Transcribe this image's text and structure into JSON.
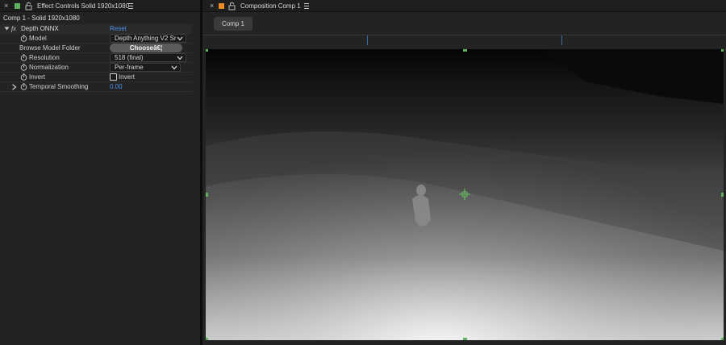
{
  "effect_controls": {
    "tab_title": "Effect Controls Solid 1920x1080",
    "layer_title": "Comp 1 - Solid 1920x1080",
    "effect": {
      "fx_badge": "fx",
      "name": "Depth ONNX",
      "reset_label": "Reset"
    },
    "properties": {
      "model": {
        "label": "Model",
        "value": "Depth Anything V2 Sm"
      },
      "browse": {
        "label": "Browse Model Folder",
        "button_label": "Chooseâ€¦"
      },
      "resolution": {
        "label": "Resolution",
        "value": "518 (final)"
      },
      "normalization": {
        "label": "Normalization",
        "value": "Per-frame"
      },
      "invert": {
        "label": "Invert",
        "checkbox_label": "Invert",
        "checked": false
      },
      "temporal_smoothing": {
        "label": "Temporal Smoothing",
        "value": "0.00"
      }
    },
    "swatch_color": "#5fb35f"
  },
  "composition": {
    "tab_title": "Composition Comp 1",
    "comp_button": "Comp 1",
    "swatch_color": "#f08a24",
    "handle_color": "#5fb35f"
  }
}
